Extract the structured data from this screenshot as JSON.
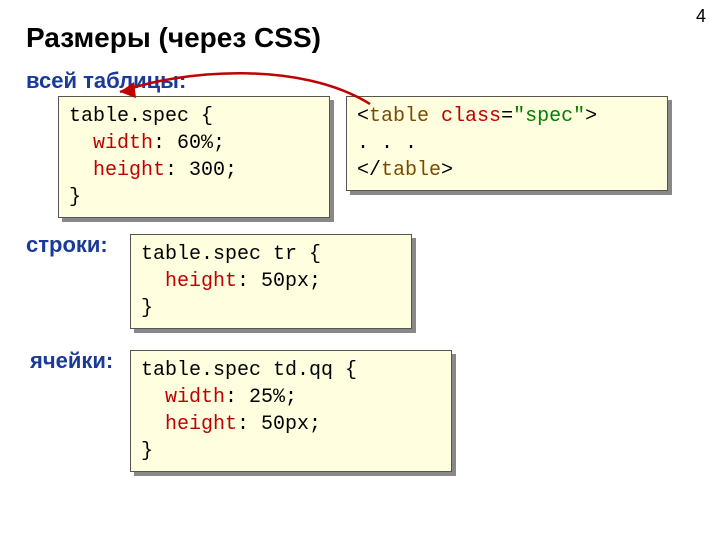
{
  "page_number": "4",
  "title": "Размеры (через CSS)",
  "labels": {
    "whole_table": "всей таблицы:",
    "row": "строки:",
    "cell": "ячейки:"
  },
  "code": {
    "box_a": {
      "line1a": "table.spec {",
      "line2_kw": "width",
      "line2_rest": ": 60%;",
      "line3_kw": "height",
      "line3_rest": ": 300;",
      "line4": "}"
    },
    "box_b": {
      "open_lt": "<",
      "open_tag": "table",
      "open_sp": " ",
      "attr_name": "class",
      "attr_eq": "=",
      "attr_val": "\"spec\"",
      "open_gt": ">",
      "mid": ". . .",
      "close_lt": "</",
      "close_tag": "table",
      "close_gt": ">"
    },
    "box_c": {
      "line1": "table.spec tr {",
      "line2_kw": "height",
      "line2_rest": ": 50px;",
      "line3": "}"
    },
    "box_d": {
      "line1": "table.spec td.qq {",
      "line2_kw": "width",
      "line2_rest": ": 25%;",
      "line3_kw": "height",
      "line3_rest": ": 50px;",
      "line4": "}"
    }
  }
}
